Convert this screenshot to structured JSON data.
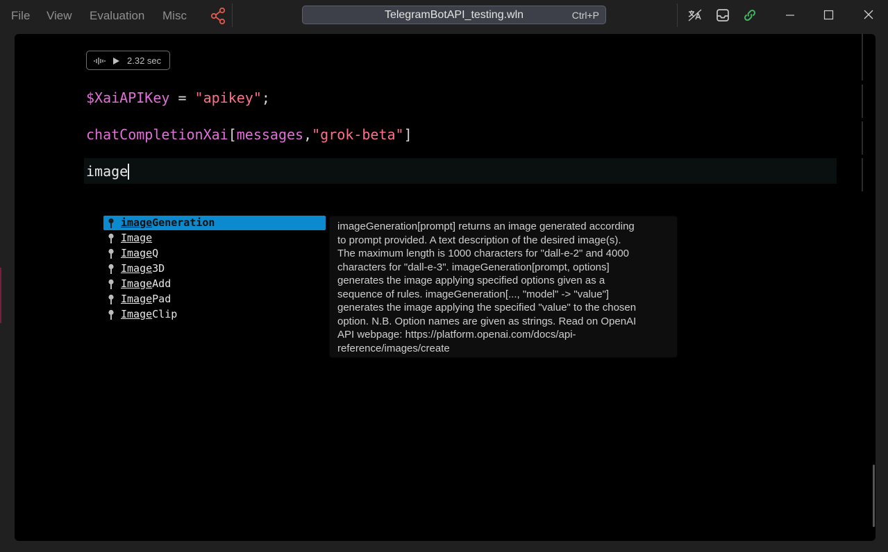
{
  "menu": {
    "file": "File",
    "view": "View",
    "evaluation": "Evaluation",
    "misc": "Misc"
  },
  "file_search": {
    "filename": "TelegramBotAPI_testing.wln",
    "shortcut": "Ctrl+P"
  },
  "icons": {
    "share": "share-icon",
    "toolbar": [
      "translate-icon",
      "inbox-icon",
      "link-icon"
    ],
    "window": [
      "minimize-icon",
      "maximize-icon",
      "close-icon"
    ]
  },
  "colors": {
    "accent": "#0c8ad0",
    "share": "#e05a4f",
    "link": "#3dbb5c",
    "symbol": "#e070d8",
    "string": "#ff6f8a"
  },
  "cell": {
    "timing": "2.32 sec",
    "line1": {
      "var": "$XaiAPIKey",
      "op": " = ",
      "str": "\"apikey\"",
      "end": ";"
    },
    "line2": {
      "fn": "chatCompletionXai",
      "open": "[",
      "arg": "messages",
      "comma": ",",
      "str": "\"grok-beta\"",
      "close": "]"
    },
    "input": "image"
  },
  "autocomplete": {
    "matched_prefix_length": 5,
    "items": [
      {
        "match": "image",
        "rest": "Generation"
      },
      {
        "match": "Image",
        "rest": ""
      },
      {
        "match": "Image",
        "rest": "Q"
      },
      {
        "match": "Image",
        "rest": "3D"
      },
      {
        "match": "Image",
        "rest": "Add"
      },
      {
        "match": "Image",
        "rest": "Pad"
      },
      {
        "match": "Image",
        "rest": "Clip"
      }
    ],
    "selected_index": 0
  },
  "documentation": {
    "lines": [
      "imageGeneration[prompt] returns an image generated according",
      "to prompt provided. A text description of the desired image(s).",
      "The maximum length is 1000 characters for \"dall-e-2\" and 4000",
      "characters for \"dall-e-3\". imageGeneration[prompt, options]",
      "generates the image applying specified options given as a",
      "sequence of rules. imageGeneration[..., \"model\" -> \"value\"]",
      "generates the image applying the specified \"value\" to the chosen",
      "option. N.B. Option names are given as strings. Read on OpenAI",
      "API webpage: https://platform.openai.com/docs/api-",
      "reference/images/create"
    ]
  }
}
